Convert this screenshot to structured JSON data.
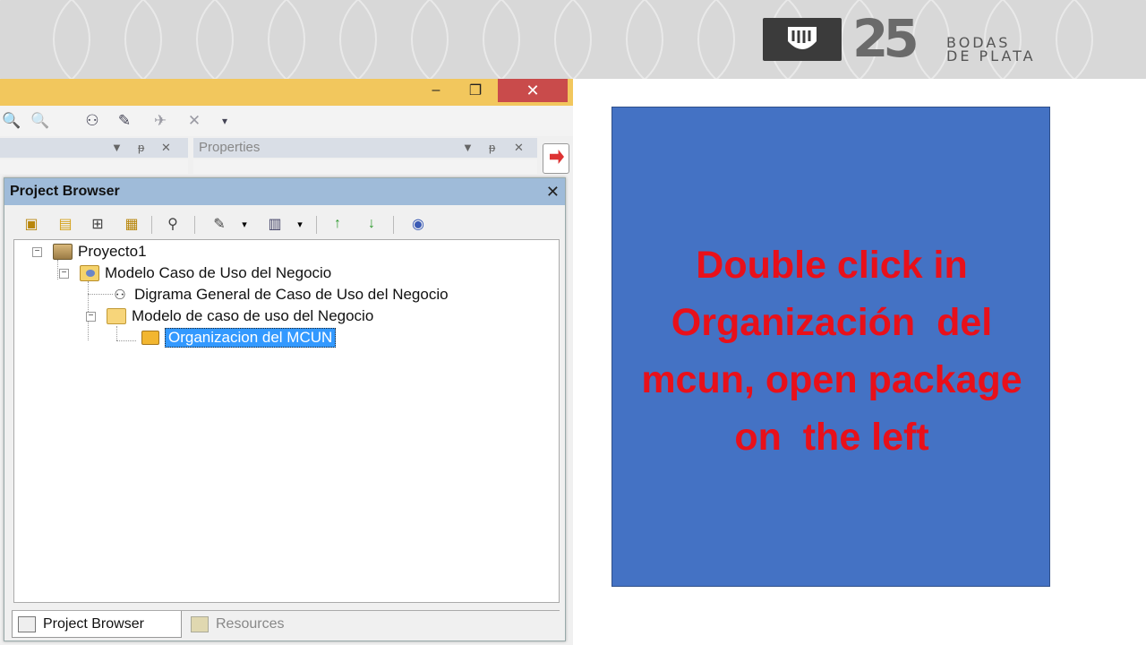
{
  "header": {
    "logo_text_line1": "BODAS",
    "logo_text_line2": "DE PLATA",
    "logo_number": "25",
    "band_color": "#d8d8d8"
  },
  "window": {
    "minimize_glyph": "–",
    "maximize_glyph": "❐",
    "close_glyph": "✕",
    "titlebar_color": "#f2c75d",
    "close_color": "#c94b4b"
  },
  "toolbar": {
    "icons": [
      "zoom-in-icon",
      "zoom-out-icon",
      "hierarchy-icon",
      "properties-icon",
      "pin-tool-icon",
      "delete-icon",
      "overflow-icon"
    ]
  },
  "panels": {
    "left_header_label": "",
    "properties_label": "Properties",
    "dropdown_glyph": "▼",
    "pin_glyph": "ᵽ",
    "close_glyph": "✕"
  },
  "project_browser": {
    "title": "Project Browser",
    "close_glyph": "✕",
    "title_color": "#9fbbd9",
    "tree": [
      {
        "label": "Proyecto1",
        "icon": "project-icon",
        "level": 0,
        "expander": "−"
      },
      {
        "label": "Modelo Caso de Uso del Negocio",
        "icon": "model-icon",
        "level": 1,
        "expander": "−"
      },
      {
        "label": "Digrama General de Caso de Uso del Negocio",
        "icon": "diagram-icon",
        "level": 2,
        "expander": ""
      },
      {
        "label": "Modelo de caso de uso del Negocio",
        "icon": "folder-icon",
        "level": 2,
        "expander": "−"
      },
      {
        "label": "Organizacion del MCUN",
        "icon": "package-icon",
        "level": 3,
        "expander": "",
        "selected": true
      }
    ],
    "tabs": [
      {
        "label": "Project Browser",
        "active": true
      },
      {
        "label": "Resources",
        "active": false
      }
    ]
  },
  "callout": {
    "lines": [
      "Double click in",
      "Organización  del",
      "mcun, open package",
      "on  the left"
    ],
    "background": "#4472c4",
    "text_color": "#e8101a"
  }
}
